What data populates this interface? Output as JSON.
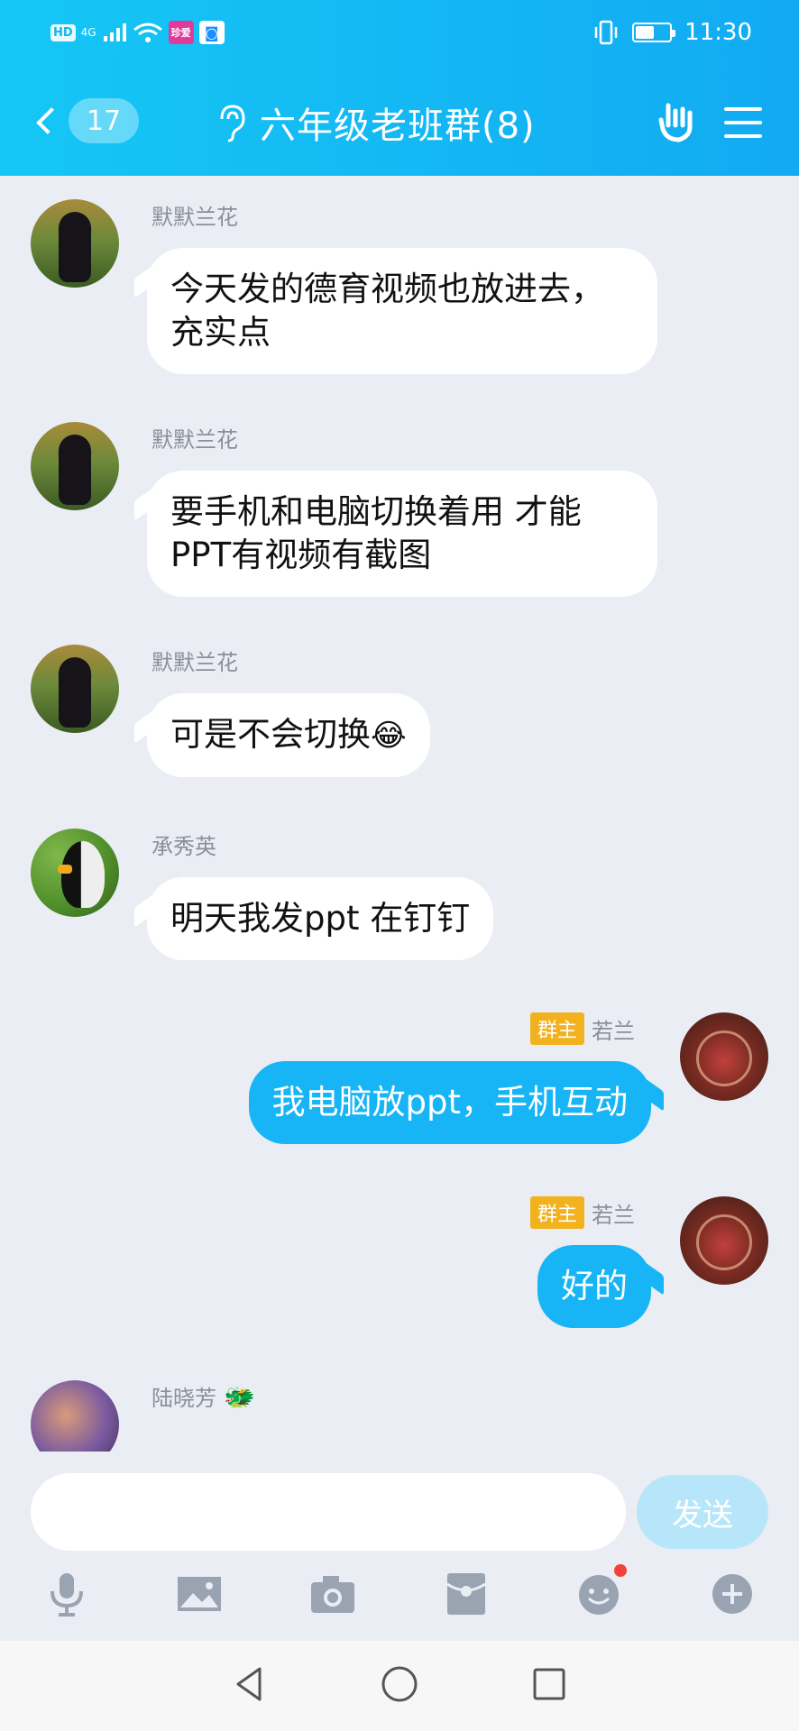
{
  "status_bar": {
    "hd": "HD",
    "network": "4G",
    "app1_label": "珍爱",
    "time": "11:30",
    "battery_level": 0.55
  },
  "header": {
    "back_count": "17",
    "title": "六年级老班群(8)"
  },
  "messages": [
    {
      "side": "in",
      "sender": "默默兰花",
      "text": "今天发的德育视频也放进去，充实点"
    },
    {
      "side": "in",
      "sender": "默默兰花",
      "text": "要手机和电脑切换着用 才能PPT有视频有截图"
    },
    {
      "side": "in",
      "sender": "默默兰花",
      "text": "可是不会切换",
      "emoji": "😂"
    },
    {
      "side": "in",
      "sender": "承秀英",
      "text": "明天我发ppt 在钉钉"
    },
    {
      "side": "out",
      "sender": "若兰",
      "role": "群主",
      "text": "我电脑放ppt，手机互动"
    },
    {
      "side": "out",
      "sender": "若兰",
      "role": "群主",
      "text": "好的"
    },
    {
      "side": "in",
      "sender": "陆晓芳",
      "badge_icon": "🐲"
    }
  ],
  "input": {
    "value": "",
    "send_label": "发送"
  },
  "toolbar": {
    "items": [
      "microphone-icon",
      "image-icon",
      "camera-icon",
      "red-packet-icon",
      "emoji-icon",
      "plus-icon"
    ],
    "emoji_has_dot": true,
    "icon_color": "#9aa3b2"
  },
  "colors": {
    "header_start": "#15c7f5",
    "header_end": "#12aaf2",
    "outgoing_bubble": "#17b5f5",
    "chat_background": "#eaedf4",
    "owner_badge": "#f2b21e"
  }
}
